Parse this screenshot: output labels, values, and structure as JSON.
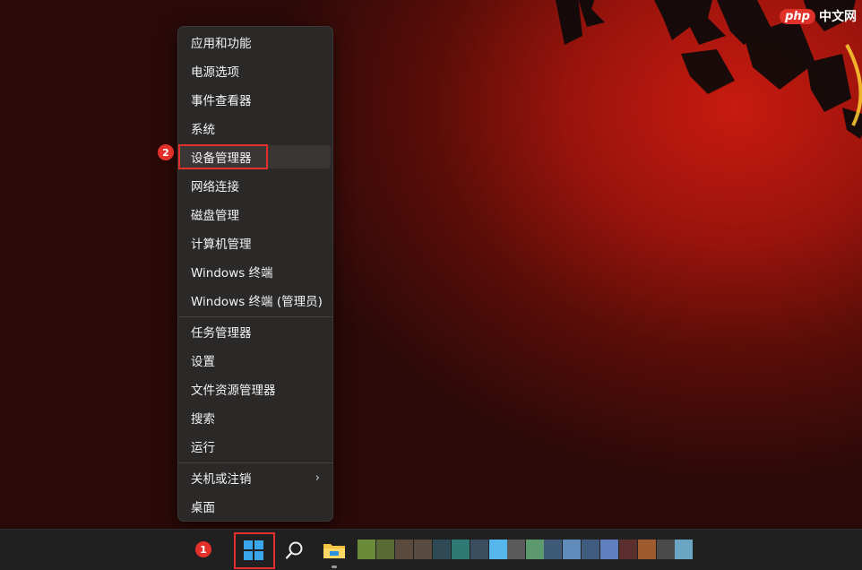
{
  "watermark": {
    "badge": "php",
    "text": "中文网"
  },
  "menu": {
    "items": [
      {
        "label": "应用和功能"
      },
      {
        "label": "电源选项"
      },
      {
        "label": "事件查看器"
      },
      {
        "label": "系统"
      },
      {
        "label": "设备管理器"
      },
      {
        "label": "网络连接"
      },
      {
        "label": "磁盘管理"
      },
      {
        "label": "计算机管理"
      },
      {
        "label": "Windows 终端"
      },
      {
        "label": "Windows 终端 (管理员)"
      },
      {
        "label": "任务管理器"
      },
      {
        "label": "设置"
      },
      {
        "label": "文件资源管理器"
      },
      {
        "label": "搜索"
      },
      {
        "label": "运行"
      },
      {
        "label": "关机或注销",
        "submenu": "›"
      },
      {
        "label": "桌面"
      }
    ]
  },
  "markers": {
    "start": "1",
    "device_manager": "2"
  },
  "colors": {
    "highlight": "#e3302b",
    "menu_bg": "#2b2828",
    "taskbar_bg": "#202020",
    "accent_start": "#3aa7ec"
  },
  "taskbar": {
    "icons": [
      "windows-start-icon",
      "search-icon",
      "file-explorer-icon"
    ],
    "tile_colors": [
      "#6b8a3a",
      "#5a6a34",
      "#5b4a3e",
      "#5a4b40",
      "#2f4a55",
      "#2f7b74",
      "#3a4e60",
      "#55b6ec",
      "#5a5a5a",
      "#5c9a6e",
      "#3e5a76",
      "#5f8bbb",
      "#3f5b7e",
      "#5f7fbf",
      "#5a2f2e",
      "#a05a30",
      "#4a4a4a",
      "#6aa6c4"
    ]
  }
}
